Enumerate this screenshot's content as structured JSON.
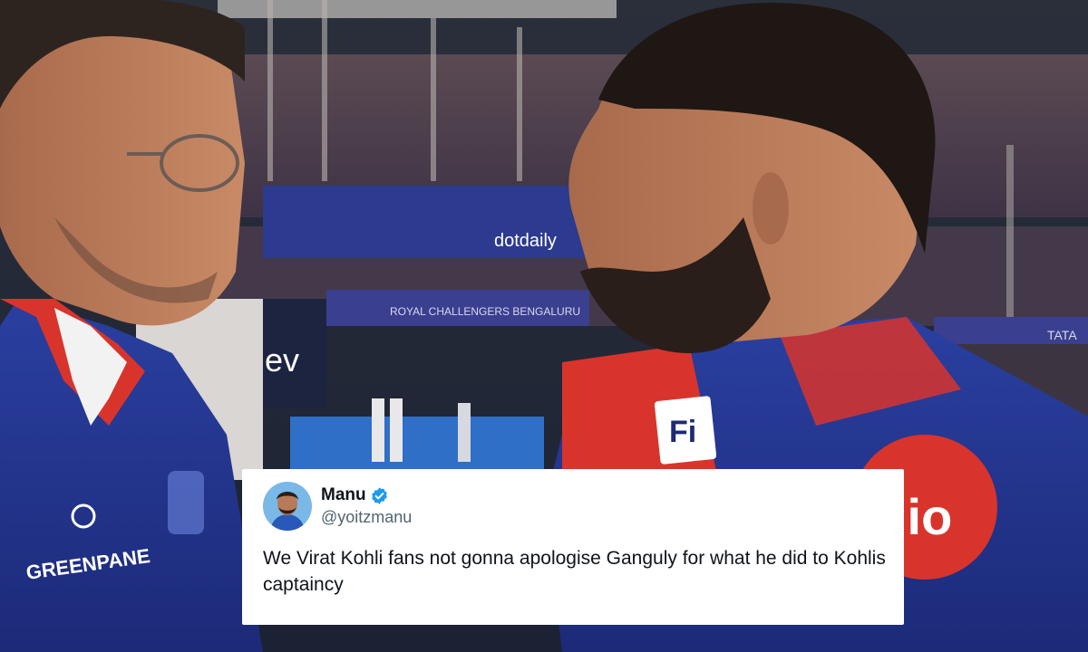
{
  "photo": {
    "stadium_banners": {
      "upper": "dotdaily",
      "lower": "ROYAL CHALLENGERS BENGALURU",
      "right": "TATA"
    },
    "jersey_texts": {
      "left_sponsor": "GREENPANE",
      "right_logo": "jio",
      "badge": "Fi"
    }
  },
  "tweet": {
    "name": "Manu",
    "handle": "@yoitzmanu",
    "text": "We Virat Kohli fans not gonna apologise Ganguly for what he did to Kohlis captaincy",
    "verified_icon": "verified-badge-icon",
    "verified_color": "#1d9bf0"
  }
}
